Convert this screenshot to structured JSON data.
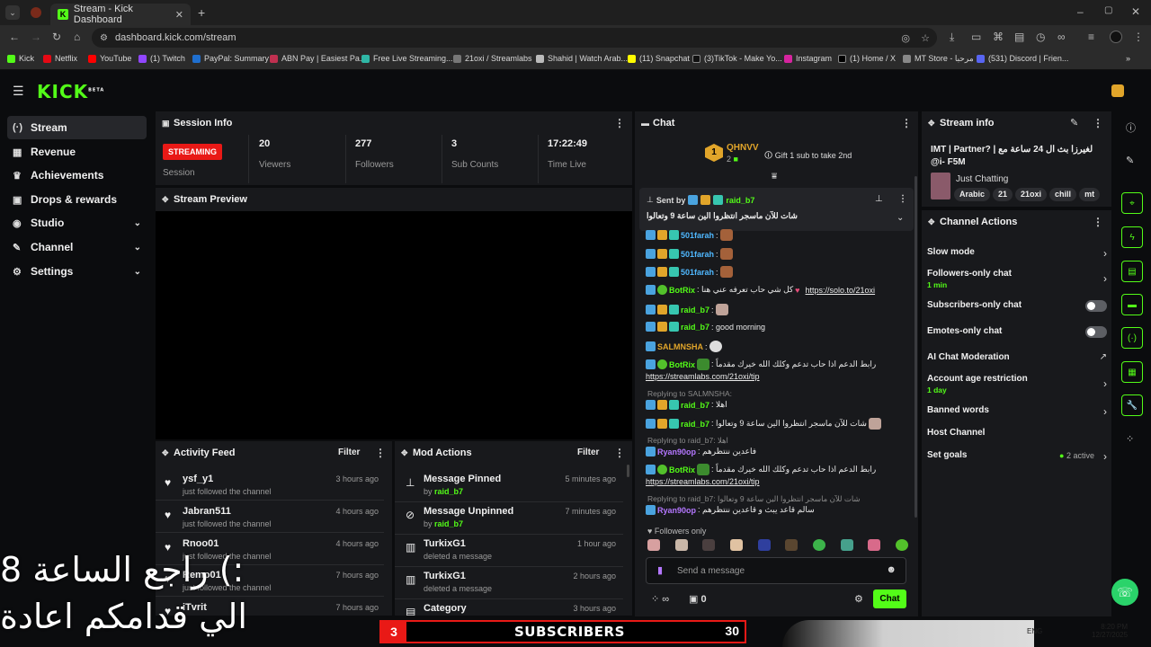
{
  "browser": {
    "tab_title": "Stream - Kick Dashboard",
    "url": "dashboard.kick.com/stream",
    "bookmarks": [
      "Kick",
      "Netflix",
      "YouTube",
      "(1) Twitch",
      "PayPal: Summary",
      "ABN Pay | Easiest Pa...",
      "Free Live Streaming...",
      "21oxi / Streamlabs",
      "Shahid | Watch Arab...",
      "(11) Snapchat",
      "(3)TikTok - Make Yo...",
      "Instagram",
      "(1) Home / X",
      "MT Store - مرحبا",
      "(531) Discord | Frien..."
    ]
  },
  "app": {
    "logo": "KICK",
    "logo_sup": "BETA"
  },
  "sidebar": {
    "items": [
      {
        "label": "Stream",
        "icon": "broadcast-icon"
      },
      {
        "label": "Revenue",
        "icon": "dollar-icon"
      },
      {
        "label": "Achievements",
        "icon": "trophy-icon"
      },
      {
        "label": "Drops & rewards",
        "icon": "gift-icon"
      },
      {
        "label": "Studio",
        "icon": "studio-icon"
      },
      {
        "label": "Channel",
        "icon": "channel-icon"
      },
      {
        "label": "Settings",
        "icon": "gear-icon"
      }
    ]
  },
  "session": {
    "title": "Session Info",
    "status": "STREAMING",
    "status_label": "Session",
    "viewers": "20",
    "viewers_label": "Viewers",
    "followers": "277",
    "followers_label": "Followers",
    "subs": "3",
    "subs_label": "Sub Counts",
    "time": "17:22:49",
    "time_label": "Time Live"
  },
  "preview": {
    "title": "Stream Preview"
  },
  "activity": {
    "title": "Activity Feed",
    "filter": "Filter",
    "rows": [
      {
        "name": "ysf_y1",
        "action": "just followed the channel",
        "time": "3 hours ago"
      },
      {
        "name": "Jabran511",
        "action": "just followed the channel",
        "time": "4 hours ago"
      },
      {
        "name": "Rnoo01",
        "action": "just followed the channel",
        "time": "4 hours ago"
      },
      {
        "name": "Remo01",
        "action": "just followed the channel",
        "time": "7 hours ago"
      },
      {
        "name": "iTvrit",
        "action": "",
        "time": "7 hours ago"
      }
    ]
  },
  "mod": {
    "title": "Mod Actions",
    "filter": "Filter",
    "rows": [
      {
        "name": "Message Pinned",
        "by": "by ",
        "who": "raid_b7",
        "time": "5 minutes ago"
      },
      {
        "name": "Message Unpinned",
        "by": "by ",
        "who": "raid_b7",
        "time": "7 minutes ago"
      },
      {
        "name": "TurkixG1",
        "by": "deleted a message",
        "who": "",
        "time": "1 hour ago"
      },
      {
        "name": "TurkixG1",
        "by": "deleted a message",
        "who": "",
        "time": "2 hours ago"
      },
      {
        "name": "Category",
        "by": "",
        "who": "",
        "time": "3 hours ago"
      }
    ]
  },
  "chat": {
    "title": "Chat",
    "gifter": "QHNVV",
    "gifter_count": "2",
    "gift_text": "Gift 1 sub to take 2nd",
    "rank": "1",
    "pinned_sent_by": "Sent by",
    "pinned_user": "raid_b7",
    "pinned_text": "شات للآن ماسجر انتظروا الين ساعة 9 وتعالوا",
    "messages": [
      {
        "user": "501farah",
        "text": ":"
      },
      {
        "user": "501farah",
        "text": ":"
      },
      {
        "user": "501farah",
        "text": ":"
      },
      {
        "user": "BotRix",
        "text": ": كل شي حاب تعرفه عني هنا",
        "link": "https://solo.to/21oxi"
      },
      {
        "user": "raid_b7",
        "text": ":"
      },
      {
        "user": "raid_b7",
        "text": ": good morning"
      },
      {
        "user": "SALMNSHA",
        "text": ":"
      },
      {
        "user": "BotRix",
        "text": ": رابط الدعم اذا حاب تدعم وكلك الله خيرك مقدماً"
      }
    ],
    "link2": "https://streamlabs.com/21oxi/tip",
    "reply1": "Replying to SALMNSHA:",
    "reply1_msg": "raid_b7",
    "reply1_text": ": اهلا",
    "msg9_user": "raid_b7",
    "msg9_text": ": شات للآن ماسجر انتظروا الين ساعة 9 وتعالوا",
    "reply2": "Replying to raid_b7: اهلا",
    "msg10_user": "Ryan90op",
    "msg10_text": ": فاعدين ننتظرهم",
    "msg11_user": "BotRix",
    "msg11_text": ": رابط الدعم اذا حاب تدعم وكلك الله خيرك مقدماً",
    "link3": "https://streamlabs.com/21oxi/tip",
    "reply3": "Replying to raid_b7: شات للآن ماسجر انتظروا الين ساعة 9 وتعالوا",
    "msg12_user": "Ryan90op",
    "msg12_text": ": سالم قاعد يبث و قاعدين ننتظرهم",
    "followers_only": "Followers only",
    "placeholder": "Send a message",
    "count": "0",
    "send": "Chat"
  },
  "stream_info": {
    "title": "Stream info",
    "stream_title": "IMT | Partner? | لغيرزا بث ال 24 ساعة مع @i- F5M",
    "category": "Just Chatting",
    "tags": [
      "Arabic",
      "21",
      "21oxi",
      "chill",
      "mt"
    ]
  },
  "actions": {
    "title": "Channel Actions",
    "slow": "Slow mode",
    "followers_only": "Followers-only chat",
    "followers_only_sub": "1 min",
    "subs_only": "Subscribers-only chat",
    "emotes_only": "Emotes-only chat",
    "ai": "AI Chat Moderation",
    "age": "Account age restriction",
    "age_sub": "1 day",
    "banned": "Banned words",
    "host": "Host Channel",
    "goals": "Set goals",
    "goals_active": "2 active"
  },
  "overlay": {
    "line1": "راجع الساعة 8 (:",
    "line2": "الي قدامكم اعادة",
    "subs_label": "SUBSCRIBERS",
    "subs_left": "3",
    "subs_right": "30"
  },
  "taskbar": {
    "time": "8:20 PM",
    "date": "12/27/2025",
    "lang": "ENG"
  },
  "colors": {
    "accent": "#53fc18",
    "streaming": "#e91916",
    "panel": "#18191c",
    "bg": "#0b0c0e"
  }
}
